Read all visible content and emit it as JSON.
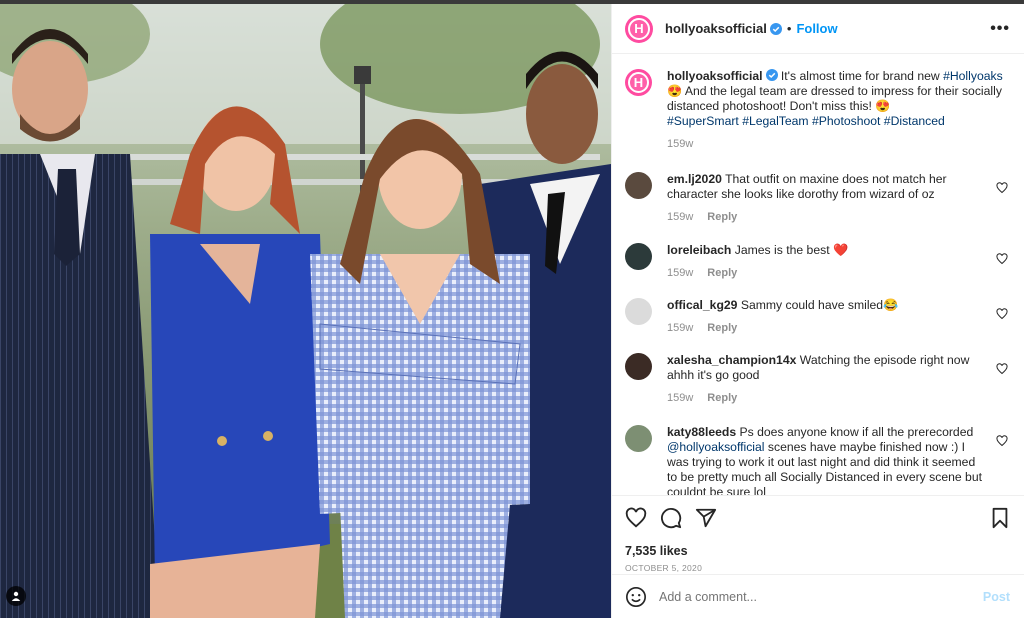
{
  "header": {
    "username": "hollyoaksofficial",
    "separator": "•",
    "follow_label": "Follow",
    "more_label": "•••",
    "avatar_letter": "H"
  },
  "caption": {
    "username": "hollyoaksofficial",
    "text_1": " It's almost time for brand new ",
    "tag_1": "#Hollyoaks",
    "text_2": " 😍 And the legal team are dressed to impress for their socially distanced photoshoot! Don't miss this! 😍",
    "hashtags": "#SuperSmart #LegalTeam #Photoshoot #Distanced",
    "time": "159w"
  },
  "comments": [
    {
      "username": "em.lj2020",
      "text": "That outfit on maxine does not match her character she looks like dorothy from wizard of oz",
      "time": "159w",
      "reply": "Reply",
      "avatar_color": "#5a4a3e"
    },
    {
      "username": "loreleibach",
      "text": "James is the best ❤️",
      "time": "159w",
      "reply": "Reply",
      "avatar_color": "#2c3a3a"
    },
    {
      "username": "offical_kg29",
      "text": "Sammy could have smiled😂",
      "time": "159w",
      "reply": "Reply",
      "avatar_color": "#dbdbdb"
    },
    {
      "username": "xalesha_champion14x",
      "text": "Watching the episode right now ahhh it's go good",
      "time": "159w",
      "reply": "Reply",
      "avatar_color": "#3b2b25"
    },
    {
      "username": "katy88leeds",
      "text_1": "Ps does anyone know if all the prerecorded ",
      "mention": "@hollyoaksofficial",
      "text_2": " scenes have maybe finished now :) I was trying to work it out last night and did think it seemed to be pretty much all Socially Distanced in every scene but couldnt be sure lol",
      "avatar_color": "#7d8f73"
    }
  ],
  "actions": {
    "likes": "7,535 likes",
    "date": "OCTOBER 5, 2020"
  },
  "add_comment": {
    "placeholder": "Add a comment...",
    "post_label": "Post"
  },
  "colors": {
    "accent": "#0095f6",
    "brand_pink": "#ff4ba0",
    "like_red": "#ed4956"
  },
  "icons": [
    "verified-icon",
    "heart-icon",
    "comment-icon",
    "share-icon",
    "bookmark-icon",
    "emoji-icon",
    "user-tag-icon"
  ]
}
